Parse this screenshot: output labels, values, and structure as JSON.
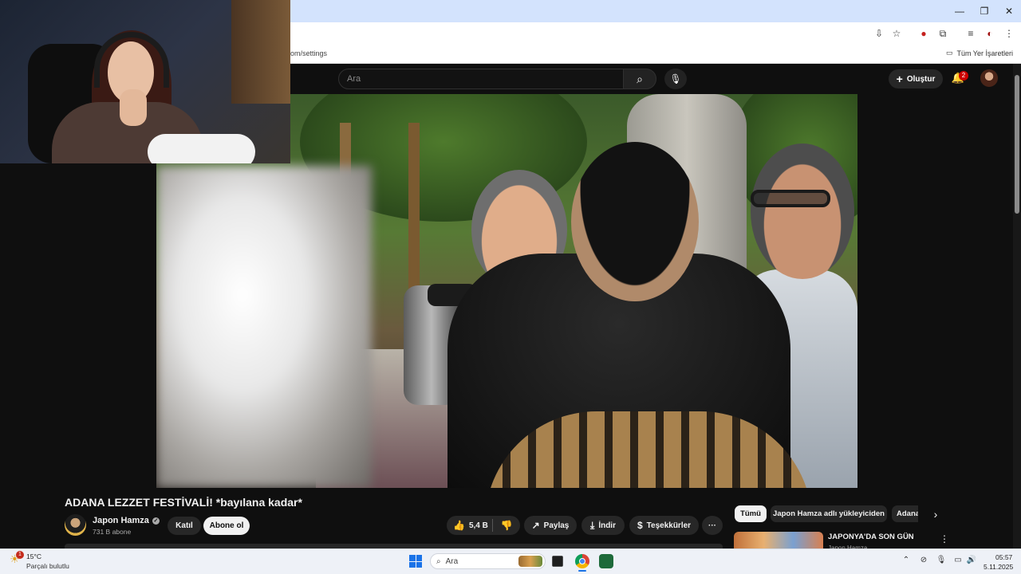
{
  "browser": {
    "window_controls": {
      "minimize": "—",
      "restore": "❐",
      "close": "✕"
    },
    "url": "om/settings",
    "bookmarks_label": "Tüm Yer İşaretleri",
    "toolbar_icons": [
      "install-icon",
      "star-icon",
      "extension-badge-icon",
      "puzzle-icon",
      "media-icon",
      "profile-icon",
      "menu-icon"
    ]
  },
  "youtube_header": {
    "search_placeholder": "Ara",
    "create_label": "Oluştur",
    "notification_count": "2"
  },
  "video": {
    "title": "ADANA LEZZET FESTİVALİ! *bayılana kadar*",
    "channel_name": "Japon Hamza",
    "subscribers": "731 B abone",
    "join_label": "Katıl",
    "subscribe_label": "Abone ol",
    "like_count": "5,4 B",
    "share_label": "Paylaş",
    "download_label": "İndir",
    "thanks_label": "Teşekkürler",
    "more_label": "···"
  },
  "sidebar": {
    "chips": [
      "Tümü",
      "Japon Hamza adlı yükleyiciden",
      "Adana"
    ],
    "recommendation": {
      "title": "JAPONYA'DA SON GÜN",
      "channel": "Japon Hamza"
    }
  },
  "taskbar": {
    "weather_temp": "15°C",
    "weather_desc": "Parçalı bulutlu",
    "weather_badge": "1",
    "search_label": "Ara",
    "time": "05:57",
    "date": "5.11.2025"
  },
  "colors": {
    "youtube_bg": "#0f0f0f",
    "chrome_titlebar": "#d3e3fd",
    "notification_red": "#cc0000"
  }
}
